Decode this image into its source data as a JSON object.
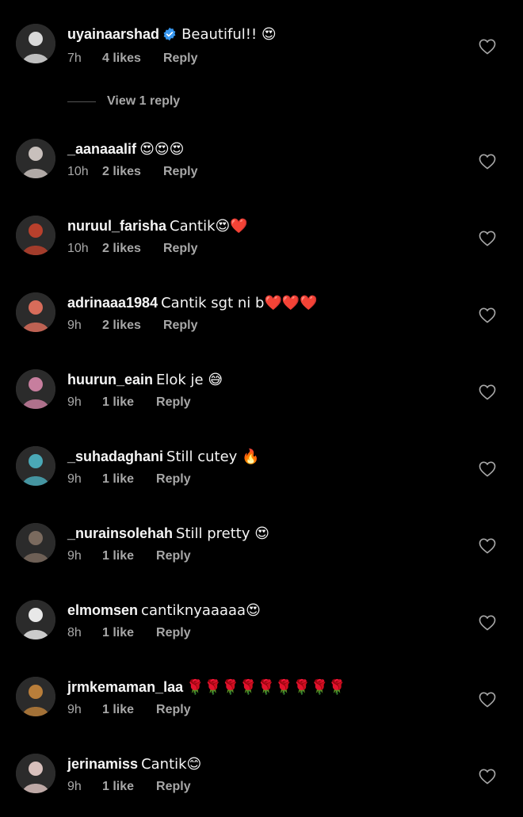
{
  "colors": {
    "background": "#000000",
    "primary_text": "#f5f5f5",
    "secondary_text": "#a8a8a8",
    "verified_badge": "#3797f0"
  },
  "comments": [
    {
      "username": "uyainaarshad",
      "verified": true,
      "text": "Beautiful!! 😍",
      "time": "7h",
      "likes": "4 likes",
      "reply": "Reply",
      "view_replies": "View 1 reply",
      "avatar_color": "#d9d9d9"
    },
    {
      "username": "_aanaaalif",
      "verified": false,
      "text": "😍😍😍",
      "time": "10h",
      "likes": "2 likes",
      "reply": "Reply",
      "avatar_color": "#c8c0bc"
    },
    {
      "username": "nuruul_farisha",
      "verified": false,
      "text": "Cantik😍❤️",
      "time": "10h",
      "likes": "2 likes",
      "reply": "Reply",
      "avatar_color": "#b8402c"
    },
    {
      "username": "adrinaaa1984",
      "verified": false,
      "text": "Cantik sgt ni b❤️❤️❤️",
      "time": "9h",
      "likes": "2 likes",
      "reply": "Reply",
      "avatar_color": "#d86c5a"
    },
    {
      "username": "huurun_eain",
      "verified": false,
      "text": "Elok je 😅",
      "time": "9h",
      "likes": "1 like",
      "reply": "Reply",
      "avatar_color": "#c77e9e"
    },
    {
      "username": "_suhadaghani",
      "verified": false,
      "text": "Still cutey 🔥",
      "time": "9h",
      "likes": "1 like",
      "reply": "Reply",
      "avatar_color": "#4aa8b6"
    },
    {
      "username": "_nurainsolehah",
      "verified": false,
      "text": "Still pretty 😍",
      "time": "9h",
      "likes": "1 like",
      "reply": "Reply",
      "avatar_color": "#7a6a5e"
    },
    {
      "username": "elmomsen",
      "verified": false,
      "text": "cantiknyaaaaa😍",
      "time": "8h",
      "likes": "1 like",
      "reply": "Reply",
      "avatar_color": "#e8e8e8"
    },
    {
      "username": "jrmkemaman_laa",
      "verified": false,
      "text": "🌹🌹🌹🌹🌹🌹🌹🌹🌹",
      "time": "9h",
      "likes": "1 like",
      "reply": "Reply",
      "avatar_color": "#b97e3a"
    },
    {
      "username": "jerinamiss",
      "verified": false,
      "text": "Cantik😊",
      "time": "9h",
      "likes": "1 like",
      "reply": "Reply",
      "avatar_color": "#d8c0bc"
    }
  ]
}
